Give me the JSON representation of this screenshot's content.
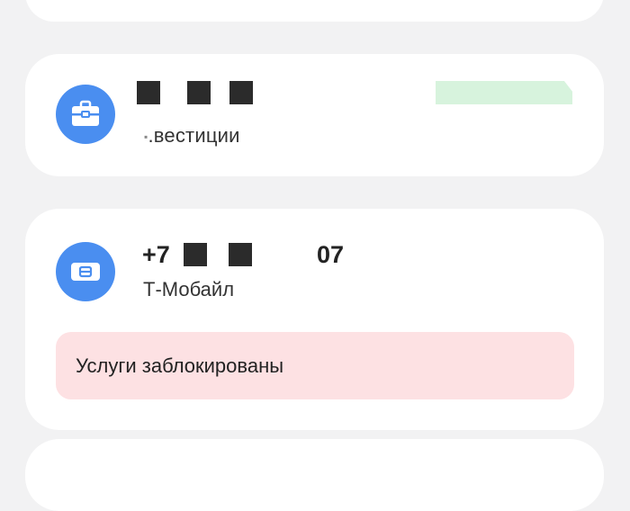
{
  "accounts": [
    {
      "id": "invest",
      "icon": "briefcase-icon",
      "subtitle_prefix": "▪",
      "subtitle": ".вестиции",
      "status_color": "#d7f3dd"
    },
    {
      "id": "mobile",
      "icon": "sim-card-icon",
      "phone_prefix": "+7",
      "phone_suffix": "07",
      "subtitle": "Т-Мобайл",
      "status_text": "Услуги заблокированы",
      "status_color": "#fde1e3"
    }
  ],
  "colors": {
    "background": "#f2f2f3",
    "card": "#ffffff",
    "icon_circle": "#4a8ef0",
    "text": "#222222"
  }
}
